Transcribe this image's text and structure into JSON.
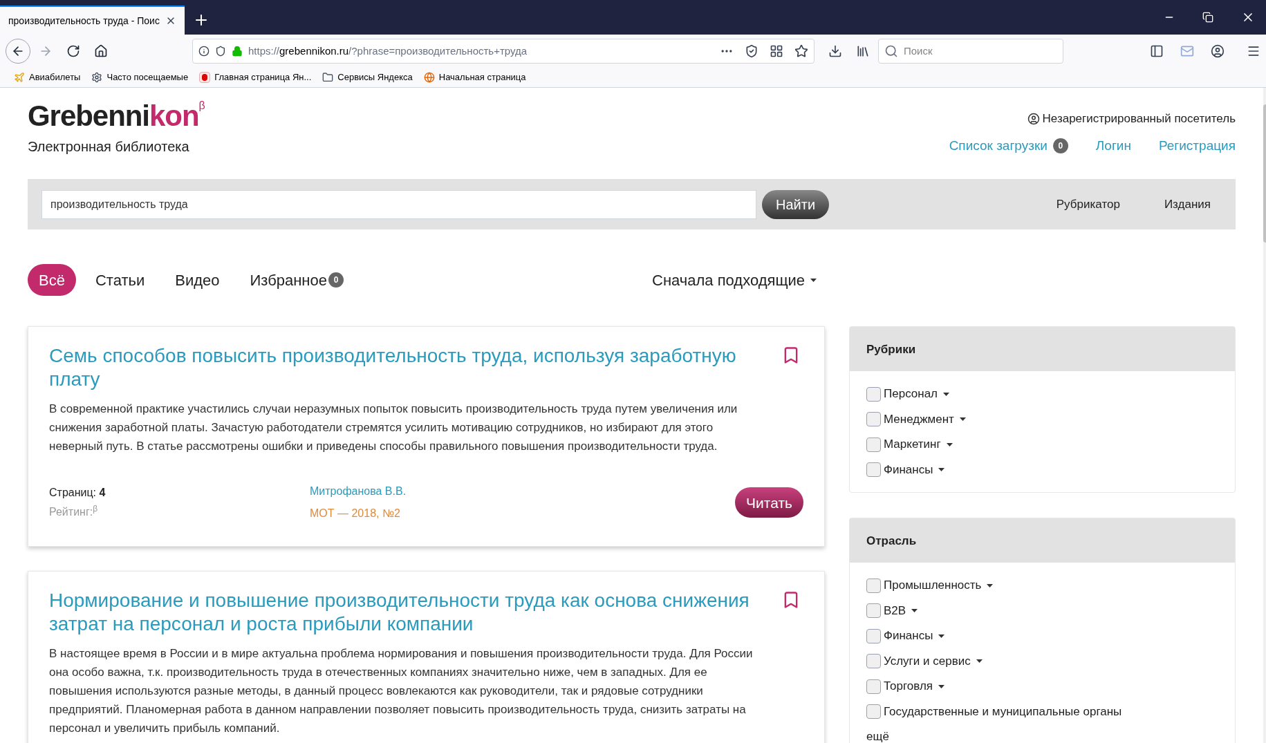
{
  "browser": {
    "tab_title": "производительность труда - Поис",
    "address": {
      "prefix": "https://",
      "domain": "grebennikon.ru",
      "rest": "/?phrase=производительность+труда"
    },
    "search_placeholder": "Поиск",
    "bookmarks": [
      {
        "kind": "plane",
        "label": "Авиабилеты"
      },
      {
        "kind": "gear",
        "label": "Часто посещаемые"
      },
      {
        "kind": "yandex",
        "label": "Главная страница Ян..."
      },
      {
        "kind": "folder",
        "label": "Сервисы Яндекса"
      },
      {
        "kind": "globe",
        "label": "Начальная страница"
      }
    ]
  },
  "header": {
    "logo": {
      "main": "Grebenni",
      "tail": "kon",
      "mark": "β"
    },
    "subtitle": "Электронная библиотека",
    "user": "Незарегистрированный посетитель",
    "download_list": "Список загрузки",
    "download_count": "0",
    "links": [
      "Логин",
      "Регистрация"
    ]
  },
  "search": {
    "value": "производительность труда",
    "button": "Найти",
    "nav": [
      "Рубрикатор",
      "Издания"
    ]
  },
  "filters": [
    {
      "label": "Всё",
      "selected": true
    },
    {
      "label": "Статьи",
      "selected": false
    },
    {
      "label": "Видео",
      "selected": false
    },
    {
      "label": "Избранное",
      "count": "0",
      "selected": false
    }
  ],
  "sort": "Сначала подходящие",
  "results": [
    {
      "title": "Семь способов повысить производительность труда, используя заработную плату",
      "abstract": "В современной практике участились случаи неразумных попыток повысить производительность труда путем увеличения или снижения заработной платы. Зачастую работодатели стремятся усилить мотивацию сотрудников, но избирают для этого неверный путь. В статье рассмотрены ошибки и приведены способы правильного повышения производительности труда.",
      "pages_label": "Страниц:",
      "pages": "4",
      "rating_label": "Рейтинг:",
      "rating_mark": "β",
      "author": "Митрофанова В.В.",
      "source": "МОТ — 2018, №2",
      "read_button": "Читать"
    },
    {
      "title": "Нормирование и повышение производительности труда как основа снижения затрат на персонал и роста прибыли компании",
      "abstract": "В настоящее время в России и в мире актуальна проблема нормирования и повышения производительности труда. Для России она особо важна, т.к. производительность труда в отечественных компаниях значительно ниже, чем в западных. Для ее повышения используются разные методы, в данный процесс вовлекаются как руководители, так и рядовые сотрудники предприятий. Планомерная работа в данном направлении позволяет повысить производительность труда, снизить затраты на персонал и увеличить прибыль компаний."
    }
  ],
  "sidebar": [
    {
      "title": "Рубрики",
      "items": [
        {
          "label": "Персонал",
          "checked": false,
          "has_menu": true
        },
        {
          "label": "Менеджмент",
          "checked": false,
          "has_menu": true
        },
        {
          "label": "Маркетинг",
          "checked": false,
          "has_menu": true
        },
        {
          "label": "Финансы",
          "checked": false,
          "has_menu": true
        }
      ]
    },
    {
      "title": "Отрасль",
      "items": [
        {
          "label": "Промышленность",
          "checked": false,
          "has_menu": true
        },
        {
          "label": "B2B",
          "checked": false,
          "has_menu": true
        },
        {
          "label": "Финансы",
          "checked": false,
          "has_menu": true
        },
        {
          "label": "Услуги и сервис",
          "checked": false,
          "has_menu": true
        },
        {
          "label": "Торговля",
          "checked": false,
          "has_menu": true
        },
        {
          "label": "Государственные и муниципальные органы",
          "checked": false,
          "has_menu": false
        }
      ],
      "more": "ещё"
    }
  ]
}
